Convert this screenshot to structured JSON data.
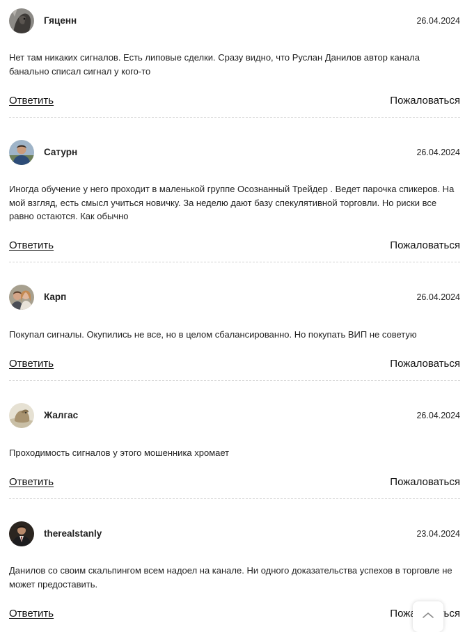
{
  "comments": [
    {
      "author": "Гяценн",
      "date": "26.04.2024",
      "text": "Нет там никаких сигналов. Есть липовые сделки. Сразу видно, что Руслан Данилов автор канала банально списал сигнал у кого-то",
      "reply_label": "Ответить",
      "report_label": "Пожаловаться",
      "avatar": "horse-photo"
    },
    {
      "author": "Сатурн",
      "date": "26.04.2024",
      "text": "Иногда обучение у него проходит в маленькой группе Осознанный Трейдер . Ведет парочка спикеров. На мой взгляд, есть смысл учиться новичку. За неделю дают базу спекулятивной торговли. Но риски все равно остаются. Как обычно",
      "reply_label": "Ответить",
      "report_label": "Пожаловаться",
      "avatar": "man-outdoor-photo"
    },
    {
      "author": "Карп",
      "date": "26.04.2024",
      "text": "Покупал сигналы. Окупились не все, но в целом сбалансированно. Но покупать ВИП не советую",
      "reply_label": "Ответить",
      "report_label": "Пожаловаться",
      "avatar": "couple-photo"
    },
    {
      "author": "Жалгас",
      "date": "26.04.2024",
      "text": "Проходимость сигналов у этого мошенника хромает",
      "reply_label": "Ответить",
      "report_label": "Пожаловаться",
      "avatar": "animal-photo"
    },
    {
      "author": "therealstanly",
      "date": "23.04.2024",
      "text": "Данилов со своим скальпингом всем надоел на канале. Ни одного доказательства успехов в торговле не может предоставить.",
      "reply_label": "Ответить",
      "report_label": "Пожаловаться",
      "avatar": "man-suit-photo"
    }
  ],
  "scroll_top_icon": "chevron-up-icon"
}
